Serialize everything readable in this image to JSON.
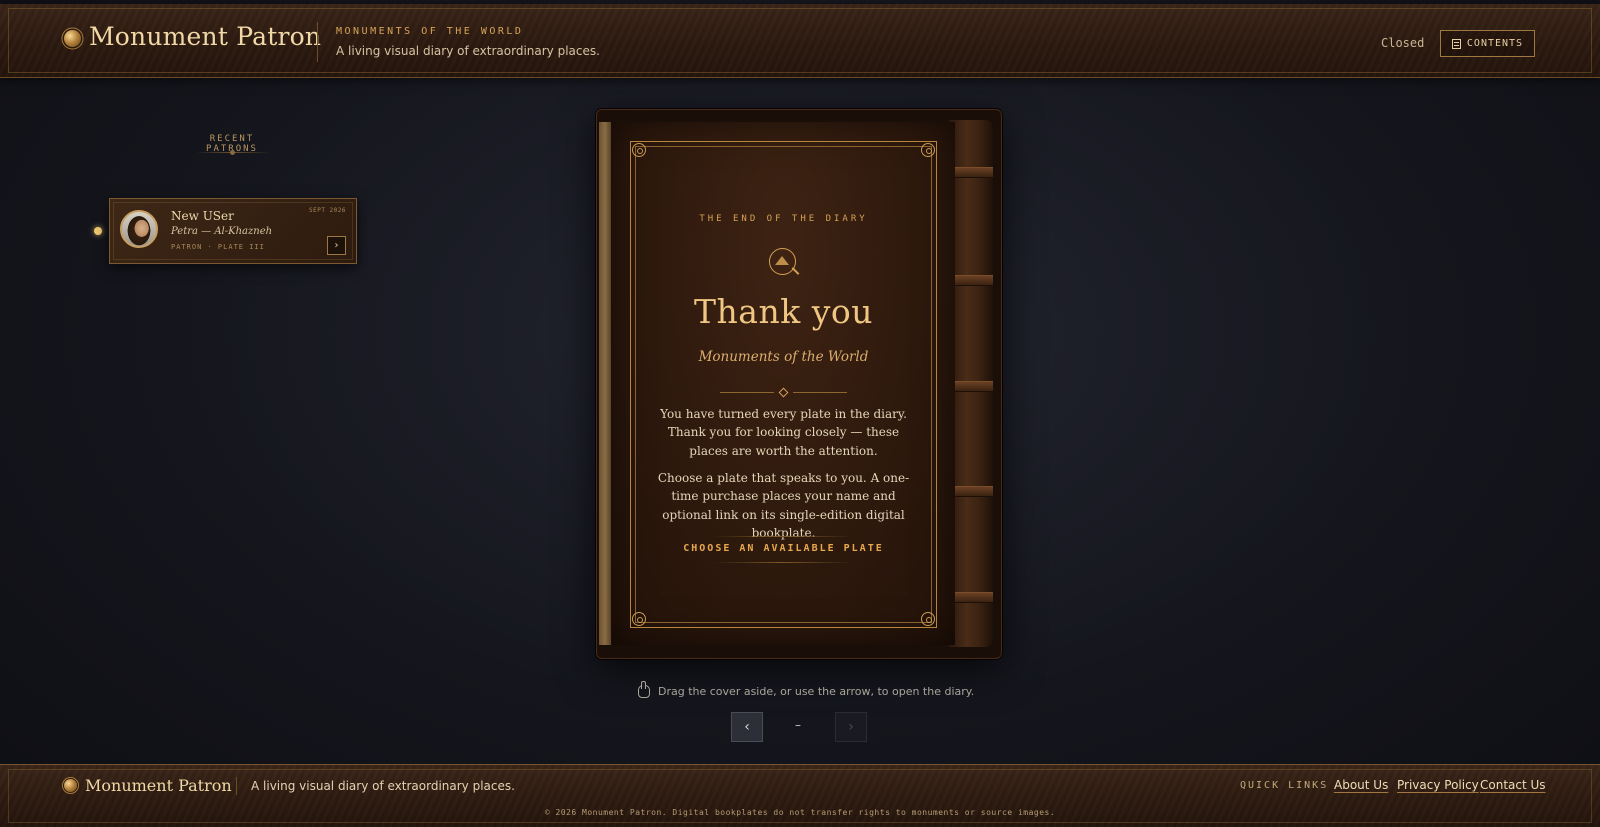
{
  "header": {
    "brand": "Monument Patron",
    "kicker": "MONUMENTS OF THE WORLD",
    "tagline": "A living visual diary of extraordinary places.",
    "status": "Closed",
    "contents_label": "CONTENTS",
    "contents_icon": "book-icon"
  },
  "patrons": {
    "heading": "RECENT PATRONS",
    "items": [
      {
        "name": "New USer",
        "place": "Petra — Al-Khazneh",
        "meta": "PATRON · PLATE III",
        "date": "SEPT 2026",
        "open_glyph": "›"
      }
    ]
  },
  "diary": {
    "kicker": "THE END OF THE DIARY",
    "title": "Thank you",
    "subtitle": "Monuments of the World",
    "paragraph1": "You have turned every plate in the diary. Thank you for looking closely — these places are worth the attention.",
    "paragraph2": "Choose a plate that speaks to you. A one-time purchase places your name and optional link on its single-edition digital bookplate.",
    "cta": "CHOOSE AN AVAILABLE PLATE"
  },
  "navigation": {
    "hint": "Drag the cover aside, or use the arrow, to open the diary.",
    "prev_glyph": "‹",
    "next_glyph": "›",
    "page_indicator": "–"
  },
  "footer": {
    "brand": "Monument Patron",
    "tagline": "A living visual diary of extraordinary places.",
    "quick_links_label": "QUICK LINKS",
    "links": [
      "About Us",
      "Privacy Policy",
      "Contact Us"
    ],
    "copyright": "© 2026 Monument Patron. Digital bookplates do not transfer rights to monuments or source images."
  },
  "colors": {
    "accent_gold": "#e8a84f",
    "title_gold": "#efc783",
    "leather": "#2c1a10",
    "background": "#15161d"
  }
}
